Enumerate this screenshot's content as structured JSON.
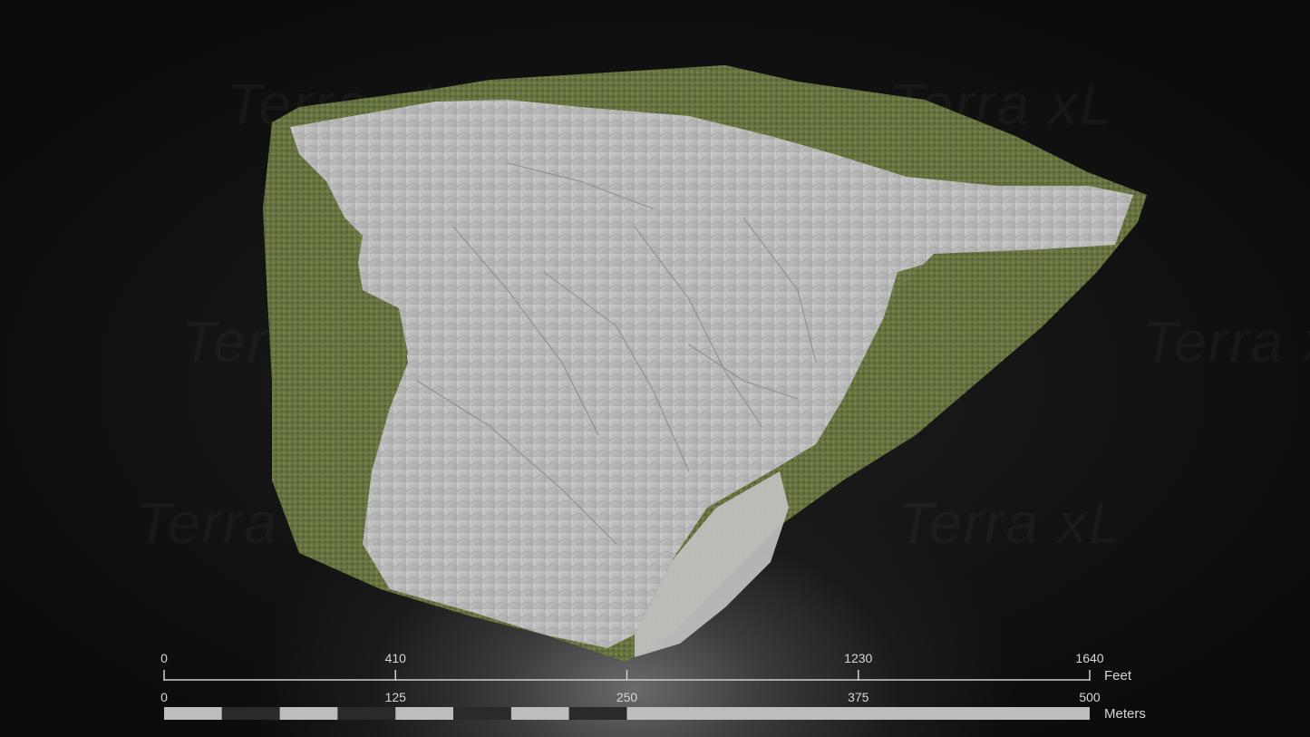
{
  "watermark": {
    "brand_text": "Terra xL"
  },
  "scale_bar": {
    "feet": {
      "unit": "Feet",
      "ticks": [
        "0",
        "410",
        "1230",
        "1640"
      ],
      "tick_values": [
        0,
        410,
        1230,
        1640
      ],
      "extra_tick_values": [
        820
      ],
      "max": 1640
    },
    "meters": {
      "unit": "Meters",
      "ticks": [
        "0",
        "125",
        "250",
        "375",
        "500"
      ],
      "tick_values": [
        0,
        125,
        250,
        375,
        500
      ],
      "max": 500,
      "segments": 16,
      "light_color": "#bdbdbd",
      "dark_color": "#2a2a2a"
    }
  },
  "colors": {
    "rock": "#bfbfbf",
    "vegetation": "#6d7a45",
    "vegetation_dark": "#4f5a31",
    "scale_line": "#cfcfcf"
  }
}
